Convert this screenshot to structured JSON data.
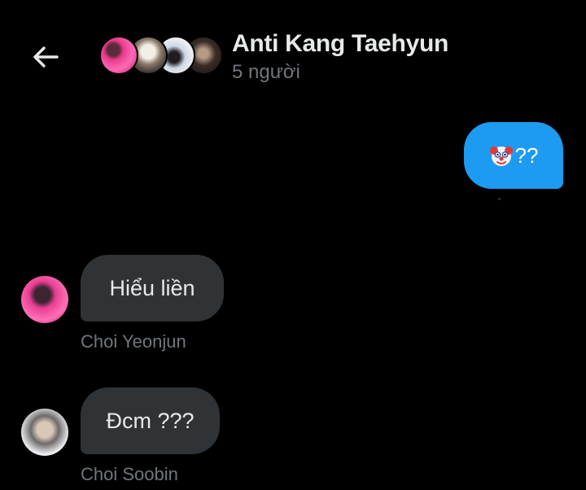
{
  "header": {
    "title": "Anti Kang Taehyun",
    "subtitle": "5 người",
    "back_icon": "arrow-left-icon",
    "participant_avatars": [
      "avatar-1",
      "avatar-2",
      "avatar-3",
      "avatar-4"
    ]
  },
  "messages": [
    {
      "direction": "outgoing",
      "emoji": "clown-face-icon",
      "text": "??",
      "bubble_color": "#1d9bf0"
    },
    {
      "direction": "incoming",
      "text": "Hiểu liền",
      "sender": "Choi Yeonjun",
      "bubble_color": "#2f3336"
    },
    {
      "direction": "incoming",
      "text": "Đcm ???",
      "sender": "Choi Soobin",
      "bubble_color": "#2f3336"
    }
  ],
  "colors": {
    "background": "#000000",
    "primary_text": "#e7e9ea",
    "secondary_text": "#71767b",
    "accent": "#1d9bf0"
  }
}
